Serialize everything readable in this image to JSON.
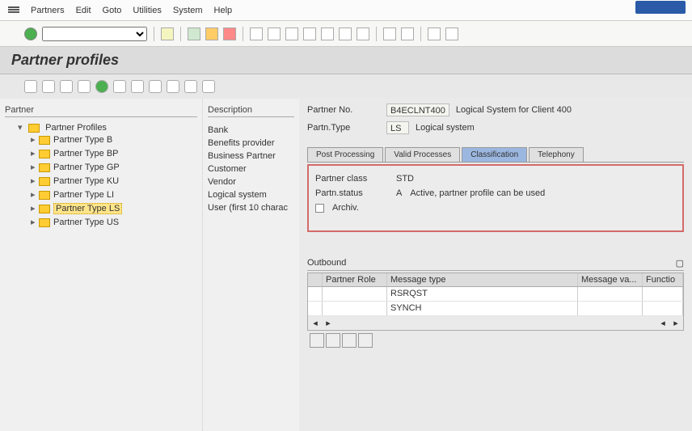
{
  "menu": {
    "items": [
      "Partners",
      "Edit",
      "Goto",
      "Utilities",
      "System",
      "Help"
    ]
  },
  "title": "Partner profiles",
  "tree": {
    "header": "Partner",
    "root": "Partner Profiles",
    "items": [
      {
        "label": "Partner Type B"
      },
      {
        "label": "Partner Type BP"
      },
      {
        "label": "Partner Type GP"
      },
      {
        "label": "Partner Type KU"
      },
      {
        "label": "Partner Type LI"
      },
      {
        "label": "Partner Type LS"
      },
      {
        "label": "Partner Type US"
      }
    ]
  },
  "desc": {
    "header": "Description",
    "rows": [
      "",
      "Bank",
      "Benefits provider",
      "Business Partner",
      "Customer",
      "Vendor",
      "Logical system",
      "User (first 10 charac"
    ]
  },
  "header": {
    "partner_no_label": "Partner No.",
    "partner_no_value": "B4ECLNT400",
    "partner_no_desc": "Logical System for Client 400",
    "partn_type_label": "Partn.Type",
    "partn_type_value": "LS",
    "partn_type_desc": "Logical system"
  },
  "tabs": {
    "t0": "Post Processing",
    "t1": "Valid Processes",
    "t2": "Classification",
    "t3": "Telephony"
  },
  "detail": {
    "class_label": "Partner class",
    "class_value": "STD",
    "status_label": "Partn.status",
    "status_code": "A",
    "status_text": "Active, partner profile can be used",
    "archiv_label": "Archiv."
  },
  "outbound": {
    "title": "Outbound",
    "cols": {
      "role": "Partner Role",
      "msg": "Message type",
      "var": "Message va...",
      "func": "Functio"
    },
    "rows": [
      {
        "role": "",
        "msg": "RSRQST"
      },
      {
        "role": "",
        "msg": "SYNCH"
      }
    ]
  }
}
